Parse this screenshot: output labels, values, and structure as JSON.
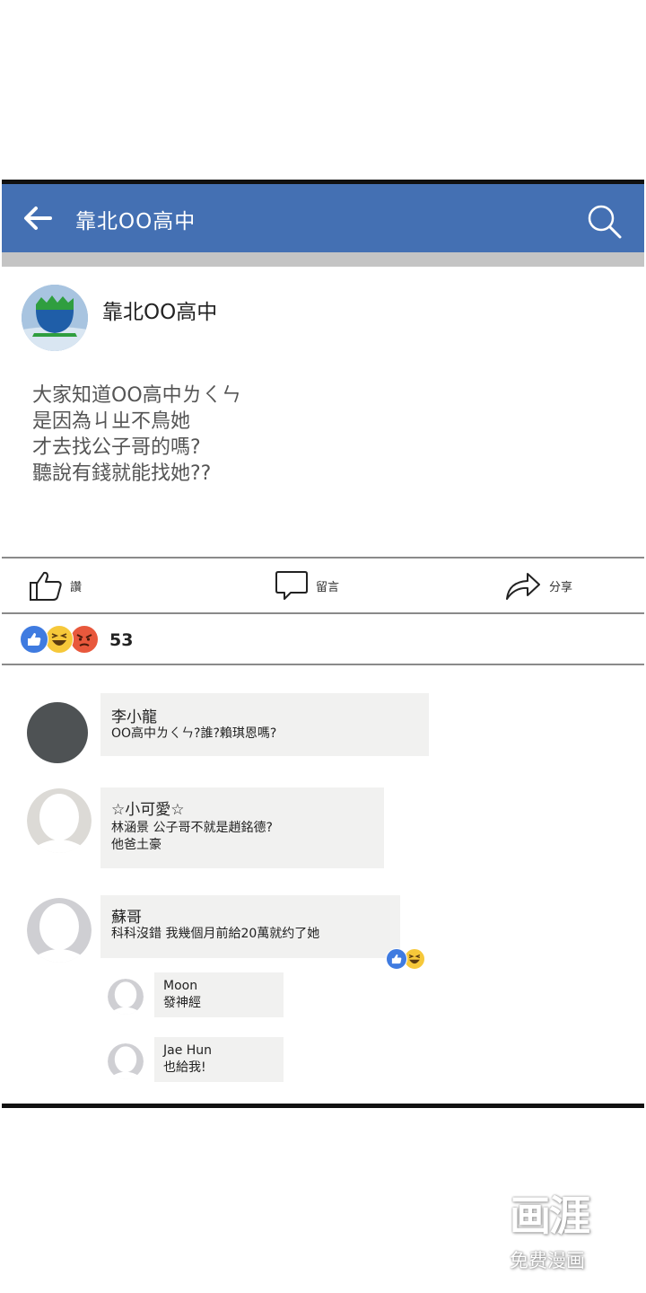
{
  "header": {
    "title": "靠北OO高中"
  },
  "page": {
    "name": "靠北OO高中"
  },
  "post": {
    "lines": [
      "大家知道OO高中ㄌㄑㄣ",
      "是因為ㄐㄓ不鳥她",
      "才去找公子哥的嗎?",
      "聽說有錢就能找她??"
    ]
  },
  "actions": {
    "like": "讚",
    "comment": "留言",
    "share": "分享"
  },
  "reactions": {
    "count": "53",
    "types": [
      "like",
      "haha",
      "angry"
    ]
  },
  "comments": [
    {
      "name": "李小龍",
      "lines": [
        "OO高中ㄌㄑㄣ?誰?賴琪恩嗎?"
      ]
    },
    {
      "name": "☆小可愛☆",
      "lines": [
        "林涵景 公子哥不就是趙銘德?",
        "他爸土豪"
      ]
    },
    {
      "name": "蘇哥",
      "lines": [
        "科科沒錯 我幾個月前給20萬就约了她"
      ],
      "reactions": [
        "like",
        "haha"
      ]
    }
  ],
  "replies": [
    {
      "name": "Moon",
      "text": "發神經"
    },
    {
      "name": "Jae Hun",
      "text": "也給我!"
    }
  ],
  "watermark": {
    "logo": "画涯",
    "sub": "免费漫画"
  },
  "colors": {
    "appbar": "#4470b3",
    "like_blue": "#3f7be0",
    "haha_yellow": "#f6c83a",
    "angry_red": "#e8583c"
  }
}
